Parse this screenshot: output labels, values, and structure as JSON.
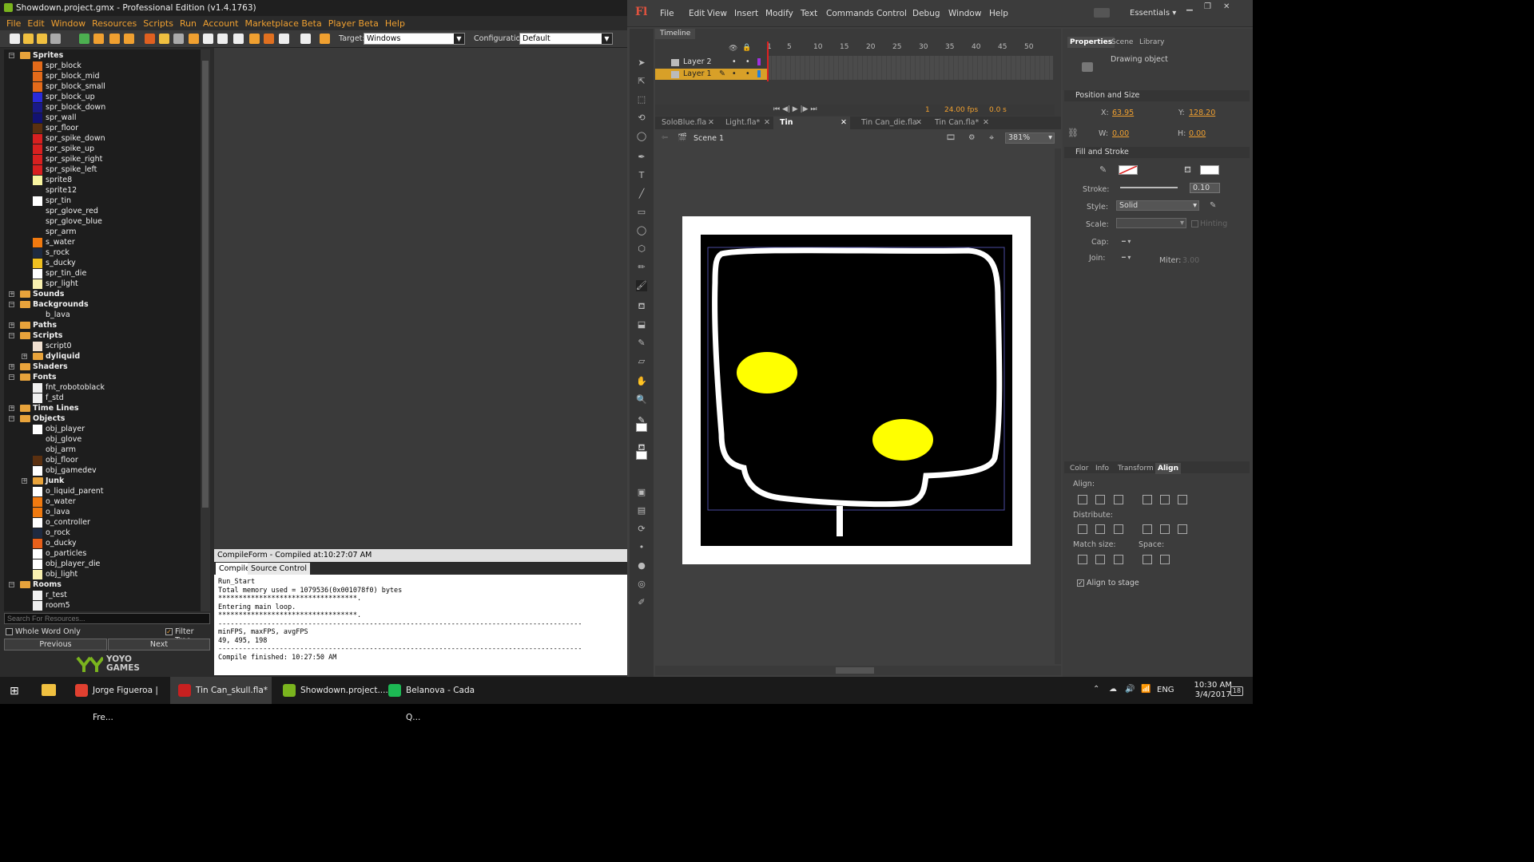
{
  "gm": {
    "title": "Showdown.project.gmx - Professional Edition (v1.4.1763)",
    "menu": [
      "File",
      "Edit",
      "Window",
      "Resources",
      "Scripts",
      "Run",
      "Account",
      "Marketplace Beta",
      "Player Beta",
      "Help"
    ],
    "target_label": "Target:",
    "target_value": "Windows",
    "config_label": "Configuration:",
    "config_value": "Default",
    "tree": [
      {
        "label": "Sprites",
        "folder": true,
        "open": true,
        "indent": 0
      },
      {
        "label": "spr_block",
        "color": "#e36a1a",
        "indent": 1
      },
      {
        "label": "spr_block_mid",
        "color": "#e36a1a",
        "indent": 1
      },
      {
        "label": "spr_block_small",
        "color": "#e36a1a",
        "indent": 1
      },
      {
        "label": "spr_block_up",
        "color": "#2a2ad8",
        "indent": 1
      },
      {
        "label": "spr_block_down",
        "color": "#1a1a88",
        "indent": 1
      },
      {
        "label": "spr_wall",
        "color": "#121272",
        "indent": 1
      },
      {
        "label": "spr_floor",
        "color": "#5a3010",
        "indent": 1
      },
      {
        "label": "spr_spike_down",
        "color": "#d82020",
        "indent": 1
      },
      {
        "label": "spr_spike_up",
        "color": "#d82020",
        "indent": 1
      },
      {
        "label": "spr_spike_right",
        "color": "#d82020",
        "indent": 1
      },
      {
        "label": "spr_spike_left",
        "color": "#d82020",
        "indent": 1
      },
      {
        "label": "sprite8",
        "color": "#f8f4a0",
        "indent": 1
      },
      {
        "label": "sprite12",
        "color": "#202020",
        "indent": 1
      },
      {
        "label": "spr_tin",
        "color": "#ffffff",
        "indent": 1
      },
      {
        "label": "spr_glove_red",
        "color": "#1d1d1d",
        "indent": 1
      },
      {
        "label": "spr_glove_blue",
        "color": "#1d1d1d",
        "indent": 1
      },
      {
        "label": "spr_arm",
        "color": "#1d1d1d",
        "indent": 1
      },
      {
        "label": "s_water",
        "color": "#f07a10",
        "indent": 1
      },
      {
        "label": "s_rock",
        "color": "#1e2a40",
        "indent": 1
      },
      {
        "label": "s_ducky",
        "color": "#f0c020",
        "indent": 1
      },
      {
        "label": "spr_tin_die",
        "color": "#ffffff",
        "indent": 1
      },
      {
        "label": "spr_light",
        "color": "#f8f0b0",
        "indent": 1
      },
      {
        "label": "Sounds",
        "folder": true,
        "open": false,
        "indent": 0
      },
      {
        "label": "Backgrounds",
        "folder": true,
        "open": true,
        "indent": 0
      },
      {
        "label": "b_lava",
        "indent": 1
      },
      {
        "label": "Paths",
        "folder": true,
        "open": false,
        "indent": 0
      },
      {
        "label": "Scripts",
        "folder": true,
        "open": true,
        "indent": 0
      },
      {
        "label": "script0",
        "color": "#f0e0d0",
        "indent": 1
      },
      {
        "label": "dyliquid",
        "folder": true,
        "plus": true,
        "indent": 1
      },
      {
        "label": "Shaders",
        "folder": true,
        "open": false,
        "indent": 0
      },
      {
        "label": "Fonts",
        "folder": true,
        "open": true,
        "indent": 0
      },
      {
        "label": "fnt_robotoblack",
        "color": "#f0f0f0",
        "indent": 1
      },
      {
        "label": "f_std",
        "color": "#f0f0f0",
        "indent": 1
      },
      {
        "label": "Time Lines",
        "folder": true,
        "open": false,
        "indent": 0
      },
      {
        "label": "Objects",
        "folder": true,
        "open": true,
        "indent": 0
      },
      {
        "label": "obj_player",
        "color": "#ffffff",
        "indent": 1
      },
      {
        "label": "obj_glove",
        "color": "#1d1d1d",
        "indent": 1
      },
      {
        "label": "obj_arm",
        "color": "#1d1d1d",
        "indent": 1
      },
      {
        "label": "obj_floor",
        "color": "#5a3010",
        "indent": 1
      },
      {
        "label": "obj_gamedev",
        "color": "#ffffff",
        "indent": 1
      },
      {
        "label": "Junk",
        "folder": true,
        "plus": true,
        "indent": 1
      },
      {
        "label": "o_liquid_parent",
        "color": "#ffffff",
        "indent": 1
      },
      {
        "label": "o_water",
        "color": "#f07a10",
        "indent": 1
      },
      {
        "label": "o_lava",
        "color": "#f07a10",
        "indent": 1
      },
      {
        "label": "o_controller",
        "color": "#ffffff",
        "indent": 1
      },
      {
        "label": "o_rock",
        "color": "#1e2a40",
        "indent": 1
      },
      {
        "label": "o_ducky",
        "color": "#e8601a",
        "indent": 1
      },
      {
        "label": "o_particles",
        "color": "#ffffff",
        "indent": 1
      },
      {
        "label": "obj_player_die",
        "color": "#ffffff",
        "indent": 1
      },
      {
        "label": "obj_light",
        "color": "#f8f0b0",
        "indent": 1
      },
      {
        "label": "Rooms",
        "folder": true,
        "open": true,
        "indent": 0
      },
      {
        "label": "r_test",
        "color": "#f0f0f0",
        "indent": 1
      },
      {
        "label": "room5",
        "color": "#f0f0f0",
        "indent": 1
      }
    ],
    "search_placeholder": "Search For Resources...",
    "whole_word": "Whole Word Only",
    "filter_tree": "Filter Tree",
    "prev": "Previous",
    "next": "Next",
    "yoyo_logo": "YOYO GAMES",
    "compile_title": "CompileForm - Compiled at:10:27:07 AM",
    "compile_tabs": [
      "Compile",
      "Source Control"
    ],
    "compile_lines": [
      "Run_Start",
      "Total memory used = 1079536(0x001078f0) bytes",
      "**********************************.",
      "Entering main loop.",
      "**********************************.",
      "-----------------------------------------------------------------------------------------",
      "minFPS, maxFPS, avgFPS",
      "49, 495, 198",
      "-----------------------------------------------------------------------------------------",
      "Compile finished: 10:27:50 AM"
    ]
  },
  "fl": {
    "logo": "Fl",
    "menu": [
      "File",
      "Edit",
      "View",
      "Insert",
      "Modify",
      "Text",
      "Commands",
      "Control",
      "Debug",
      "Window",
      "Help"
    ],
    "workspace": "Essentials",
    "timeline_tab": "Timeline",
    "ruler": [
      "1",
      "5",
      "10",
      "15",
      "20",
      "25",
      "30",
      "35",
      "40",
      "45",
      "50"
    ],
    "layers": [
      "Layer 2",
      "Layer 1"
    ],
    "fps": "24.00 fps",
    "time": "0.0 s",
    "frame": "1",
    "doc_tabs": [
      "SoloBlue.fla",
      "Light.fla*",
      "Tin Can_skull.fla*",
      "Tin Can_die.fla",
      "Tin Can.fla*"
    ],
    "active_doc": 2,
    "scene": "Scene 1",
    "zoom": "381%",
    "props_tabs": [
      "Properties",
      "Scene",
      "Library"
    ],
    "object_type": "Drawing object",
    "pos_size": "Position and Size",
    "x_label": "X:",
    "x_val": "63.95",
    "y_label": "Y:",
    "y_val": "128.20",
    "w_label": "W:",
    "w_val": "0.00",
    "h_label": "H:",
    "h_val": "0.00",
    "fill_stroke": "Fill and Stroke",
    "stroke_label": "Stroke:",
    "stroke_val": "0.10",
    "style_label": "Style:",
    "style_val": "Solid",
    "scale_label": "Scale:",
    "hinting": "Hinting",
    "cap_label": "Cap:",
    "join_label": "Join:",
    "miter_label": "Miter:",
    "miter_val": "3.00",
    "panel_tabs": [
      "Color",
      "Info",
      "Transform",
      "Align"
    ],
    "align_label": "Align:",
    "distribute_label": "Distribute:",
    "match_label": "Match size:",
    "space_label": "Space:",
    "align_stage": "Align to stage"
  },
  "taskbar": {
    "items": [
      {
        "label": "Jorge Figueroa | Fre...",
        "color": "#e04030"
      },
      {
        "label": "Tin Can_skull.fla*",
        "color": "#c82020"
      },
      {
        "label": "Showdown.project....",
        "color": "#7ab41e"
      },
      {
        "label": "Belanova - Cada Q...",
        "color": "#1db954"
      }
    ],
    "lang": "ENG",
    "time": "10:30 AM",
    "date": "3/4/2017",
    "notif": "18"
  }
}
